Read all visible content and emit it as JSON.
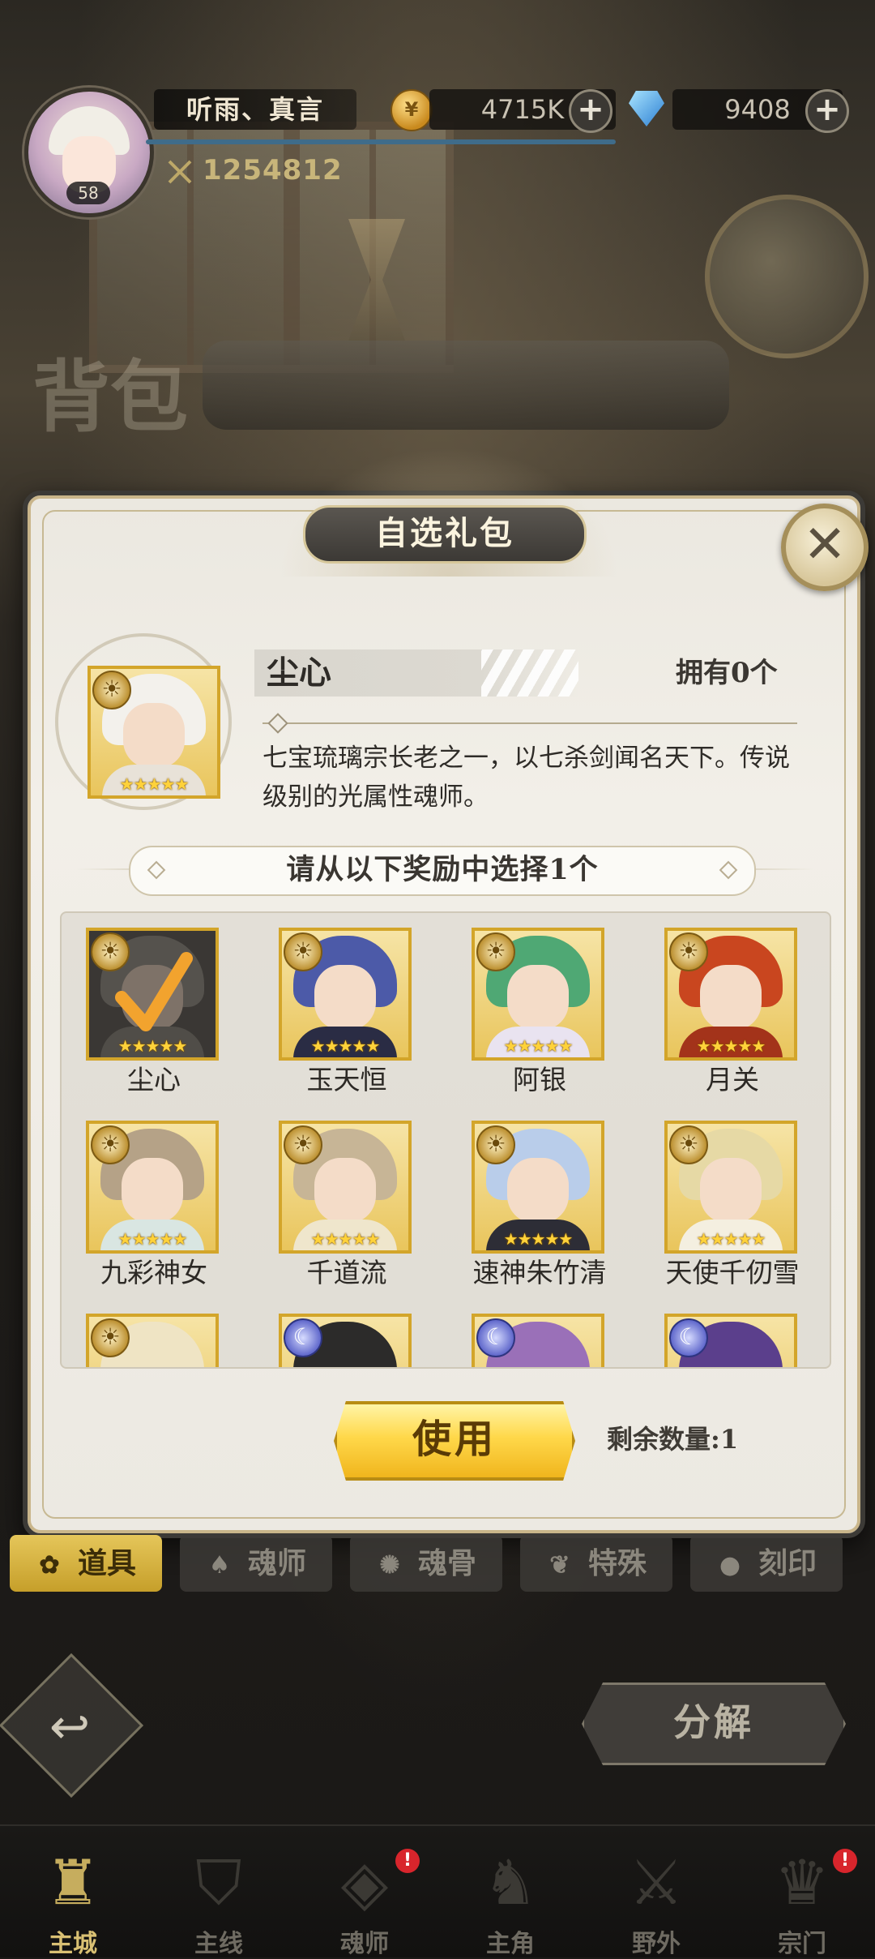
{
  "player": {
    "name": "听雨、真言",
    "level": "58",
    "power": "1254812"
  },
  "resources": {
    "gold": "4715K",
    "gems": "9408"
  },
  "screen_title": "背包",
  "dialog": {
    "title": "自选礼包",
    "item": {
      "name": "尘心",
      "owned": "拥有0个",
      "description": "七宝琉璃宗长老之一，以七杀剑闻名天下。传说级别的光属性魂师。"
    },
    "choose_prompt": "请从以下奖励中选择1个",
    "rewards": [
      {
        "name": "尘心",
        "stars": "★★★★★",
        "attribute": "sun-icon",
        "selected": true
      },
      {
        "name": "玉天恒",
        "stars": "★★★★★",
        "attribute": "sun-icon",
        "selected": false
      },
      {
        "name": "阿银",
        "stars": "★★★★★",
        "attribute": "sun-icon",
        "selected": false
      },
      {
        "name": "月关",
        "stars": "★★★★★",
        "attribute": "sun-icon",
        "selected": false
      },
      {
        "name": "九彩神女",
        "stars": "★★★★★",
        "attribute": "sun-icon",
        "selected": false
      },
      {
        "name": "千道流",
        "stars": "★★★★★",
        "attribute": "sun-icon",
        "selected": false
      },
      {
        "name": "速神朱竹清",
        "stars": "★★★★★",
        "attribute": "sun-icon",
        "selected": false
      },
      {
        "name": "天使千仞雪",
        "stars": "★★★★★",
        "attribute": "sun-icon",
        "selected": false
      }
    ],
    "use_button": "使用",
    "remaining": "剩余数量:1"
  },
  "tabs": [
    {
      "label": "道具",
      "icon": "bag-icon",
      "active": true
    },
    {
      "label": "魂师",
      "icon": "hood-icon",
      "active": false
    },
    {
      "label": "魂骨",
      "icon": "bone-icon",
      "active": false
    },
    {
      "label": "特殊",
      "icon": "wing-icon",
      "active": false
    },
    {
      "label": "刻印",
      "icon": "orb-icon",
      "active": false
    }
  ],
  "decompose_button": "分解",
  "nav": [
    {
      "label": "主城",
      "icon": "castle-icon",
      "active": true,
      "alert": false
    },
    {
      "label": "主线",
      "icon": "shield-icon",
      "active": false,
      "alert": false
    },
    {
      "label": "魂师",
      "icon": "crystal-icon",
      "active": false,
      "alert": true
    },
    {
      "label": "主角",
      "icon": "helmet-icon",
      "active": false,
      "alert": false
    },
    {
      "label": "野外",
      "icon": "sword-icon",
      "active": false,
      "alert": false
    },
    {
      "label": "宗门",
      "icon": "crest-icon",
      "active": false,
      "alert": true
    }
  ],
  "alert_mark": "!",
  "colors": {
    "accent_gold": "#d3a52a",
    "dialog_bg": "#ece9e2",
    "title_pill": "#4a4742"
  }
}
